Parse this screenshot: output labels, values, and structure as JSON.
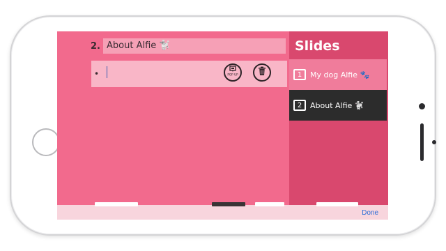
{
  "editor": {
    "slide_number": "2.",
    "slide_title": "About Alfie 🐩",
    "bullet_marker": "•",
    "popup_button_label": "POP UP"
  },
  "sidebar": {
    "title": "Slides",
    "items": [
      {
        "number": "1",
        "label": "My dog Alfie 🐾",
        "selected": false
      },
      {
        "number": "2",
        "label": "About Alfie 🐩",
        "selected": true
      }
    ]
  },
  "keyboard_toolbar": {
    "done_label": "Done"
  },
  "colors": {
    "editor_bg": "#f26a8d",
    "sidebar_bg": "#d9486e",
    "selected_item_bg": "#2c2c2c",
    "link_blue": "#2f6fd6"
  },
  "icons": [
    "popup-icon",
    "trash-icon"
  ]
}
